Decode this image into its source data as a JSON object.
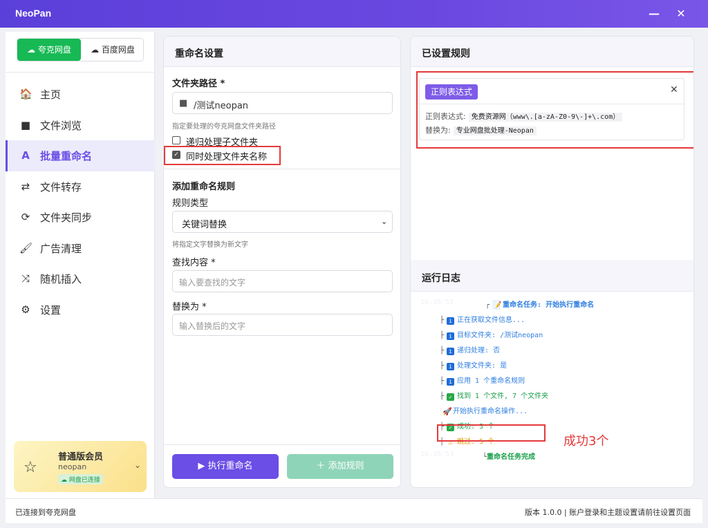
{
  "window": {
    "title": "NeoPan",
    "minimize": "—",
    "close": "✕"
  },
  "sidebar": {
    "pan_tabs": [
      {
        "label": "夸克网盘",
        "icon": "cloud-icon"
      },
      {
        "label": "百度网盘",
        "icon": "cloud-icon"
      }
    ],
    "items": [
      {
        "label": "主页",
        "icon": "home-icon",
        "glyph": "🏠"
      },
      {
        "label": "文件浏览",
        "icon": "folder-icon",
        "glyph": "■"
      },
      {
        "label": "批量重命名",
        "icon": "rename-icon",
        "glyph": "A"
      },
      {
        "label": "文件转存",
        "icon": "transfer-icon",
        "glyph": "⇄"
      },
      {
        "label": "文件夹同步",
        "icon": "sync-icon",
        "glyph": "⟳"
      },
      {
        "label": "广告清理",
        "icon": "brush-icon",
        "glyph": "🖌"
      },
      {
        "label": "随机插入",
        "icon": "shuffle-icon",
        "glyph": "⤨"
      },
      {
        "label": "设置",
        "icon": "gear-icon",
        "glyph": "⚙"
      }
    ],
    "active_index": 2,
    "member": {
      "title": "普通版会员",
      "user": "neopan",
      "status": "网盘已连接"
    }
  },
  "rename_panel": {
    "title": "重命名设置",
    "folder_label": "文件夹路径 *",
    "folder_value": "/测试neopan",
    "folder_hint": "指定要处理的夸克网盘文件夹路径",
    "recursive_label": "递归处理子文件夹",
    "recursive_checked": false,
    "process_folders_label": "同时处理文件夹名称",
    "process_folders_checked": true,
    "add_rule_title": "添加重命名规则",
    "rule_type_label": "规则类型",
    "rule_type_value": "关键词替换",
    "rule_type_hint": "将指定文字替换为新文字",
    "find_label": "查找内容 *",
    "find_placeholder": "输入要查找的文字",
    "replace_label": "替换为 *",
    "replace_placeholder": "输入替换后的文字",
    "exec_button": "▶ 执行重命名",
    "add_button": "＋ 添加规则"
  },
  "rules_panel": {
    "title": "已设置规则",
    "rules": [
      {
        "tag": "正则表达式",
        "regex_label": "正则表达式:",
        "regex_value": "免费资源网（www\\.[a-zA-Z0-9\\-]+\\.com）",
        "replace_label": "替换为:",
        "replace_value": "专业网盘批处理-Neopan"
      }
    ]
  },
  "log_panel": {
    "title": "运行日志",
    "lines": [
      {
        "ts": "16:35:52",
        "prefix": "┌",
        "icon": "memo",
        "text": "重命名任务: 开始执行重命名",
        "color": "blue",
        "bold": true
      },
      {
        "prefix": "├",
        "icon": "info",
        "text": "正在获取文件信息...",
        "color": "blue"
      },
      {
        "prefix": "├",
        "icon": "info",
        "text": "目标文件夹: /测试neopan",
        "color": "blue"
      },
      {
        "prefix": "├",
        "icon": "info",
        "text": "递归处理: 否",
        "color": "blue"
      },
      {
        "prefix": "├",
        "icon": "info",
        "text": "处理文件夹: 是",
        "color": "blue"
      },
      {
        "prefix": "├",
        "icon": "info",
        "text": "应用 1 个重命名规则",
        "color": "blue"
      },
      {
        "prefix": "├",
        "icon": "ok",
        "text": "找到 1 个文件, 7 个文件夹",
        "color": "green"
      },
      {
        "prefix": "",
        "icon": "rocket",
        "text": "开始执行重命名操作...",
        "color": "blue"
      },
      {
        "prefix": "├",
        "icon": "ok",
        "text": "成功: 3 个",
        "color": "green"
      },
      {
        "prefix": "├",
        "icon": "warn",
        "text": "跳过: 5 个",
        "color": "orange"
      },
      {
        "ts": "16:35:53",
        "prefix": "└",
        "icon": "",
        "text": "重命名任务完成",
        "color": "green",
        "bold": true
      }
    ]
  },
  "annotation": {
    "text": "成功3个"
  },
  "statusbar": {
    "left": "已连接到夸克网盘",
    "right": "版本 1.0.0 | 账户登录和主题设置请前往设置页面"
  },
  "colors": {
    "accent": "#6a4ee6",
    "green": "#17b955",
    "highlight": "#e33a3a"
  }
}
